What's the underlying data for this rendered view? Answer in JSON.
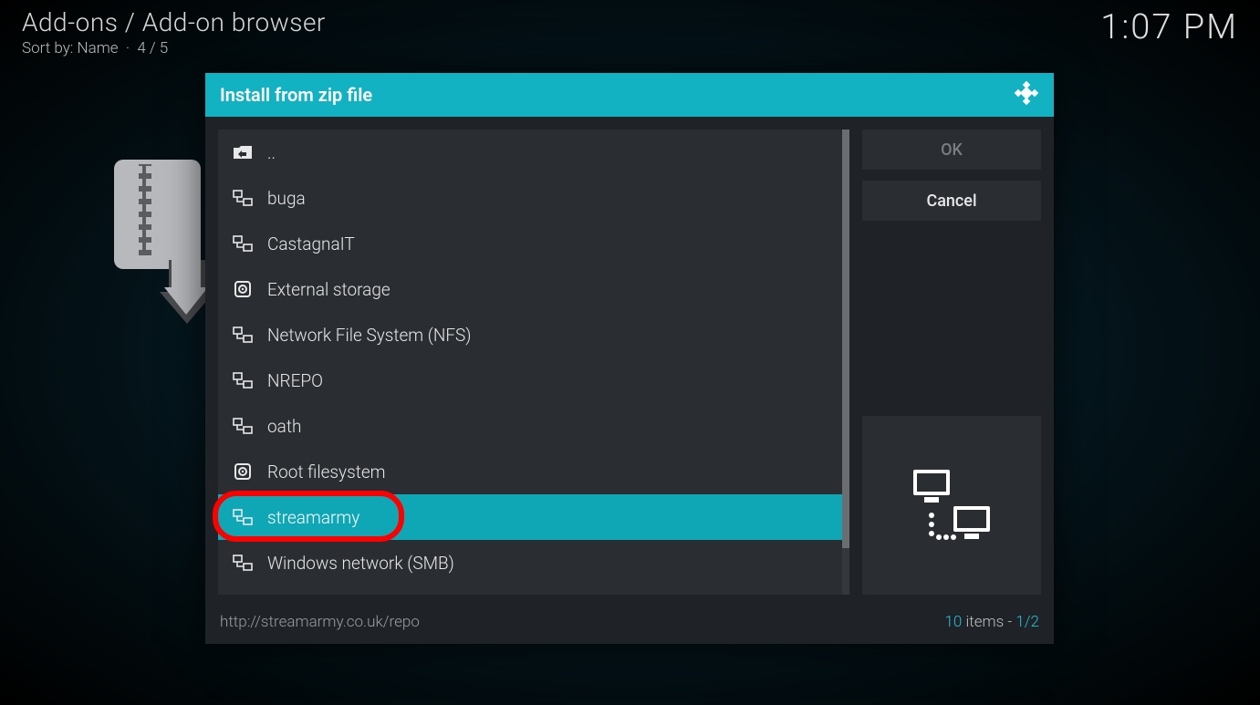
{
  "header": {
    "breadcrumb": "Add-ons / Add-on browser",
    "sort_prefix": "Sort by: ",
    "sort_value": "Name",
    "sort_count": "4 / 5"
  },
  "clock": "1:07 PM",
  "dialog": {
    "title": "Install from zip file",
    "items": [
      {
        "label": "..",
        "icon": "folder-up",
        "selected": false
      },
      {
        "label": "buga",
        "icon": "network",
        "selected": false
      },
      {
        "label": "CastagnaIT",
        "icon": "network",
        "selected": false
      },
      {
        "label": "External storage",
        "icon": "disk",
        "selected": false
      },
      {
        "label": "Network File System (NFS)",
        "icon": "network",
        "selected": false
      },
      {
        "label": "NREPO",
        "icon": "network",
        "selected": false
      },
      {
        "label": "oath",
        "icon": "network",
        "selected": false
      },
      {
        "label": "Root filesystem",
        "icon": "disk",
        "selected": false
      },
      {
        "label": "streamarmy",
        "icon": "network",
        "selected": true
      },
      {
        "label": "Windows network (SMB)",
        "icon": "network",
        "selected": false
      }
    ],
    "buttons": {
      "ok": "OK",
      "cancel": "Cancel"
    },
    "footer_path": "http://streamarmy.co.uk/repo",
    "footer_total": "10",
    "footer_items_word": " items - ",
    "footer_page": "1/2"
  },
  "highlight_index": 8
}
